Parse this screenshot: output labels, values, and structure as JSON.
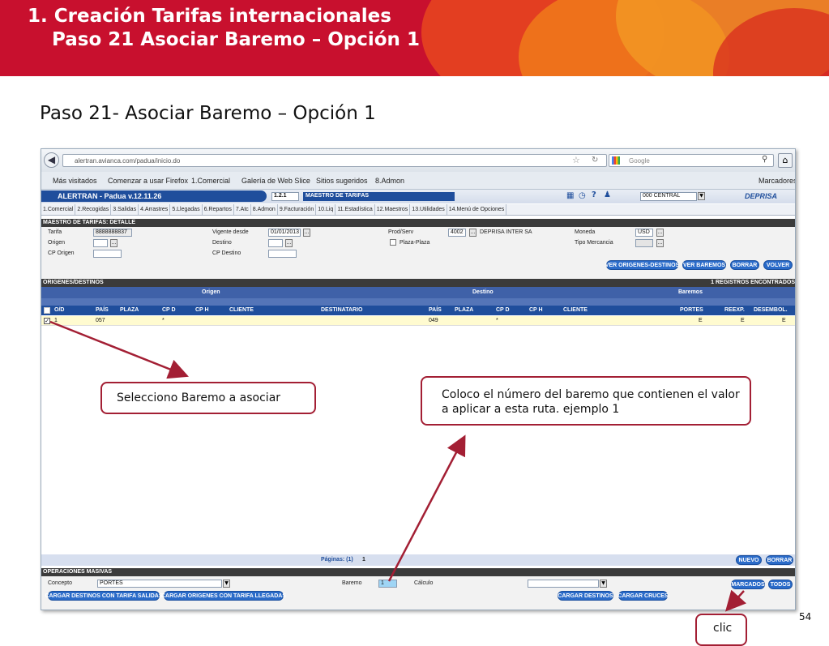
{
  "slide": {
    "title_line1": "1. Creación Tarifas internacionales",
    "title_line2": "Paso 21 Asociar Baremo – Opción 1",
    "subtitle": "Paso 21- Asociar Baremo – Opción 1",
    "page_number": "54"
  },
  "callouts": {
    "select": "Selecciono Baremo a asociar",
    "number": "Coloco el número del baremo que contienen el valor a aplicar a esta ruta. ejemplo 1",
    "click": "clic"
  },
  "browser": {
    "url": "alertran.avianca.com/padua/inicio.do",
    "search_placeholder": "Google",
    "bookmarks": [
      "Más visitados",
      "Comenzar a usar Firefox",
      "1.Comercial",
      "Galería de Web Slice",
      "Sitios sugeridos",
      "8.Admon"
    ],
    "bookmarks_right": "Marcadores"
  },
  "app": {
    "title": "ALERTRAN - Padua v.12.11.26",
    "code": "1.2.1",
    "screen_name": "MAESTRO DE TARIFAS",
    "office": "000 CENTRAL",
    "logo": "DEPRISA",
    "menu": [
      "1.Comercial",
      "2.Recogidas",
      "3.Salidas",
      "4.Arrastres",
      "5.Llegadas",
      "6.Repartos",
      "7.Atc",
      "8.Admon",
      "9.Facturación",
      "10.Liq",
      "11.Estadística",
      "12.Maestros",
      "13.Utilidades",
      "14.Menú de Opciones"
    ]
  },
  "detail": {
    "section_title": "MAESTRO DE TARIFAS: DETALLE",
    "labels": {
      "tarifa": "Tarifa",
      "origen": "Origen",
      "cp_origen": "CP Origen",
      "vigente": "Vigente desde",
      "destino": "Destino",
      "cp_destino": "CP Destino",
      "prod_serv": "Prod/Serv",
      "plaza_plaza": "Plaza-Plaza",
      "moneda": "Moneda",
      "tipo_mercancia": "Tipo Mercancia"
    },
    "values": {
      "tarifa": "8888888837",
      "vigente": "01/01/2013",
      "prod_code": "4002",
      "prod_name": "DEPRISA INTER SA",
      "moneda": "USD"
    },
    "buttons": [
      "VER ORIGENES-DESTINOS",
      "VER BAREMOS",
      "BORRAR",
      "VOLVER"
    ]
  },
  "od": {
    "section_title": "ORIGENES/DESTINOS",
    "records": "1 REGISTROS ENCONTRADOS",
    "groups": [
      "Origen",
      "Destino",
      "Baremos"
    ],
    "columns": [
      "O/D",
      "PAÍS",
      "PLAZA",
      "CP D",
      "CP H",
      "CLIENTE",
      "DESTINATARIO",
      "PAÍS",
      "PLAZA",
      "CP D",
      "CP H",
      "CLIENTE",
      "PORTES",
      "REEXP.",
      "DESEMBOL."
    ],
    "row": {
      "od": "1",
      "pais_o": "057",
      "cpd_o": "*",
      "pais_d": "049",
      "cpd_d": "*",
      "portes": "E",
      "reexp": "E",
      "desembol": "E"
    },
    "pages_label": "Páginas: (1)",
    "pages_value": "1",
    "buttons": [
      "NUEVO",
      "BORRAR"
    ]
  },
  "massive": {
    "section_title": "OPERACIONES MASIVAS",
    "concepto_label": "Concepto",
    "concepto_value": "PORTES",
    "baremo_label": "Baremo",
    "baremo_value": "1",
    "calculo_label": "Cálculo",
    "buttons_right": [
      "MARCADOS",
      "TODOS"
    ],
    "buttons_bottom_left": [
      "CARGAR DESTINOS CON TARIFA SALIDAS",
      "CARGAR ORIGENES CON TARIFA LLEGADAS"
    ],
    "buttons_bottom_right": [
      "CARGAR DESTINOS",
      "CARGAR CRUCES"
    ]
  },
  "colors": {
    "brand_red": "#c8102e",
    "app_blue": "#1f4e9c",
    "callout_border": "#a31f34",
    "selected_row": "#fffbd0"
  }
}
